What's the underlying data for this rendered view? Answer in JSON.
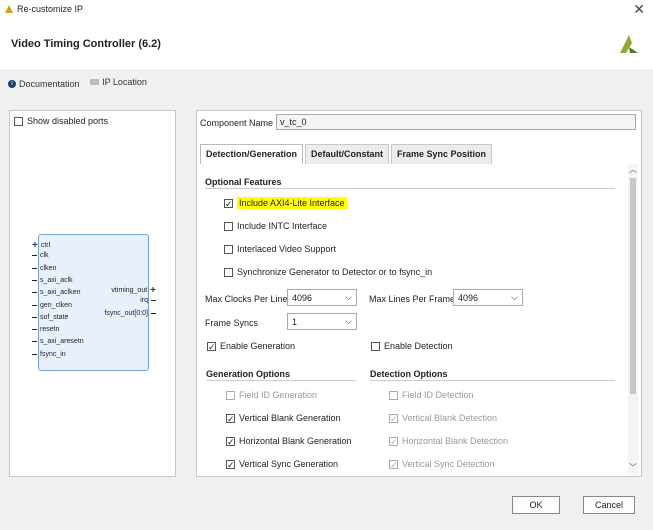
{
  "window": {
    "title": "Re-customize IP",
    "close": "✕"
  },
  "header": {
    "title": "Video Timing Controller (6.2)"
  },
  "links": {
    "documentation": "Documentation",
    "ip_location": "IP Location"
  },
  "left": {
    "show_disabled_label": "Show disabled ports"
  },
  "block": {
    "left_ports": [
      "ctrl",
      "clk",
      "clken",
      "s_axi_aclk",
      "s_axi_aclken",
      "gen_clken",
      "sof_state",
      "resetn",
      "s_axi_aresetn",
      "fsync_in"
    ],
    "right_ports": [
      "vtiming_out",
      "irq",
      "fsync_out[0:0]"
    ]
  },
  "component": {
    "label": "Component Name",
    "value": "v_tc_0"
  },
  "tabs": [
    "Detection/Generation",
    "Default/Constant",
    "Frame Sync Position"
  ],
  "optional": {
    "title": "Optional Features",
    "axi": "Include AXI4-Lite Interface",
    "intc": "Include INTC Interface",
    "interlaced": "Interlaced Video Support",
    "sync": "Synchronize Generator to Detector or to fsync_in"
  },
  "fields": {
    "max_clocks_label": "Max Clocks Per Line",
    "max_clocks_value": "4096",
    "max_lines_label": "Max Lines Per Frame",
    "max_lines_value": "4096",
    "frame_syncs_label": "Frame Syncs",
    "frame_syncs_value": "1"
  },
  "enable": {
    "generation": "Enable Generation",
    "detection": "Enable Detection"
  },
  "gen_options": {
    "title": "Generation Options",
    "field_id": "Field ID Generation",
    "vblank": "Vertical Blank Generation",
    "hblank": "Horizontal Blank Generation",
    "vsync": "Vertical Sync Generation"
  },
  "det_options": {
    "title": "Detection Options",
    "field_id": "Field ID Detection",
    "vblank": "Vertical Blank Detection",
    "hblank": "Horizontal Blank Detection",
    "vsync": "Vertical Sync Detection"
  },
  "buttons": {
    "ok": "OK",
    "cancel": "Cancel"
  },
  "colors": {
    "highlight": "#ffff00",
    "block_fill": "#e8f1fb",
    "logo": "#8cab2f"
  }
}
